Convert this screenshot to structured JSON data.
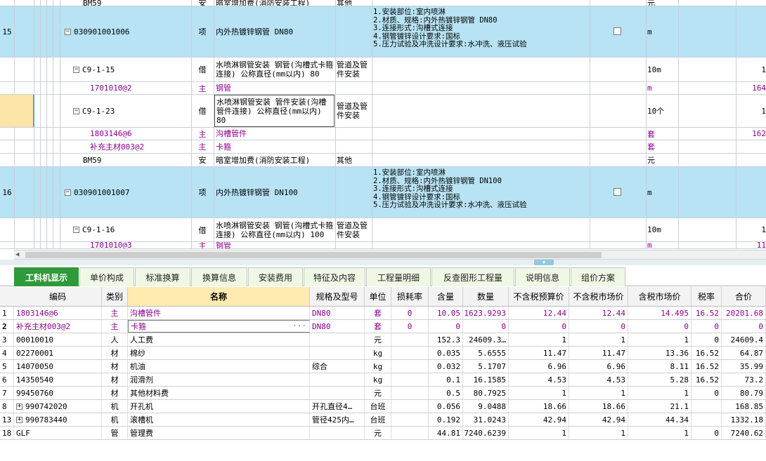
{
  "upper": {
    "columns": [
      "",
      "",
      "code",
      "type",
      "name",
      "category",
      "features",
      "check",
      "unit",
      "extra1",
      "extra2"
    ],
    "rows": [
      {
        "num": "",
        "code": "BM59",
        "type": "安",
        "name": "暗室增加费(消防安装工程)",
        "cat": "其他",
        "desc": [],
        "unit": "元",
        "tail": "",
        "blue": false,
        "purple": false
      },
      {
        "num": "15",
        "code": "030901001006",
        "type": "项",
        "name": "内外热镀锌钢管 DN80",
        "cat": "",
        "desc": [
          "1.安装部位:室内喷淋",
          "2.材质、规格:内外热镀锌钢管 DN80",
          "3.连接形式:沟槽式连接",
          "4.钢管镀锌设计要求:国标",
          "5.压力试验及冲洗设计要求:水冲洗、液压试验"
        ],
        "unit": "m",
        "tail": "",
        "blue": true,
        "purple": false
      },
      {
        "num": "",
        "code": "C9-1-15",
        "type": "借",
        "name": "水喷淋钢管安装 钢管(沟槽式卡箍连接) 公称直径(mm以内) 80",
        "cat": "管道及管件安装",
        "desc": [],
        "unit": "10m",
        "tail": "1",
        "blue": false,
        "purple": false
      },
      {
        "num": "",
        "code": "1701010@2",
        "type": "主",
        "name": "钢管",
        "cat": "",
        "desc": [],
        "unit": "m",
        "tail": "164",
        "blue": false,
        "purple": true
      },
      {
        "num": "",
        "code": "C9-1-23",
        "type": "借",
        "name": "水喷淋钢管安装 管件安装(沟槽管件连接) 公称直径(mm以内) 80",
        "cat": "管道及管件安装",
        "desc": [],
        "unit": "10个",
        "tail": "1",
        "blue": false,
        "purple": false
      },
      {
        "num": "",
        "code": "1803146@6",
        "type": "主",
        "name": "沟槽管件",
        "cat": "",
        "desc": [],
        "unit": "套",
        "tail": "162",
        "blue": false,
        "purple": true
      },
      {
        "num": "",
        "code": "补充主材003@2",
        "type": "主",
        "name": "卡箍",
        "cat": "",
        "desc": [],
        "unit": "套",
        "tail": "",
        "blue": false,
        "purple": true
      },
      {
        "num": "",
        "code": "BM59",
        "type": "安",
        "name": "暗室增加费(消防安装工程)",
        "cat": "其他",
        "desc": [],
        "unit": "元",
        "tail": "",
        "blue": false,
        "purple": false
      },
      {
        "num": "16",
        "code": "030901001007",
        "type": "项",
        "name": "内外热镀锌钢管 DN100",
        "cat": "",
        "desc": [
          "1.安装部位:室内喷淋",
          "2.材质、规格:内外热镀锌钢管 DN100",
          "3.连接形式:沟槽式连接",
          "4.钢管镀锌设计要求:国标",
          "5.压力试验及冲洗设计要求:水冲洗、液压试验"
        ],
        "unit": "m",
        "tail": "",
        "blue": true,
        "purple": false
      },
      {
        "num": "",
        "code": "C9-1-16",
        "type": "借",
        "name": "水喷淋钢管安装 钢管(沟槽式卡箍连接) 公称直径(mm以内) 100",
        "cat": "管道及管件安装",
        "desc": [],
        "unit": "10m",
        "tail": "1",
        "blue": false,
        "purple": false
      },
      {
        "num": "",
        "code": "1701010@3",
        "type": "主",
        "name": "钢管",
        "cat": "",
        "desc": [],
        "unit": "m",
        "tail": "11",
        "blue": false,
        "purple": true
      }
    ]
  },
  "tabs": [
    "工料机显示",
    "单价构成",
    "标准换算",
    "换算信息",
    "安装费用",
    "特征及内容",
    "工程量明细",
    "反查图形工程量",
    "说明信息",
    "组价方案"
  ],
  "lower": {
    "headers": [
      "编码",
      "类别",
      "名称",
      "规格及型号",
      "单位",
      "损耗率",
      "含量",
      "数量",
      "不含税预算价",
      "不含税市场价",
      "含税市场价",
      "税率",
      "合价"
    ],
    "rows": [
      {
        "idx": "1",
        "code": "1803146@6",
        "type": "主",
        "name": "沟槽管件",
        "spec": "DN80",
        "unit": "套",
        "loss": "0",
        "qty": "10.05",
        "amount": "1623.9293",
        "p1": "12.44",
        "p2": "12.44",
        "p3": "14.495",
        "tax": "16.52",
        "total": "20201.68",
        "purple": true,
        "plus": false
      },
      {
        "idx": "2",
        "code": "补充主材003@2",
        "type": "主",
        "name": "卡箍",
        "spec": "DN80",
        "unit": "套",
        "loss": "0",
        "qty": "0",
        "amount": "0",
        "p1": "0",
        "p2": "0",
        "p3": "0",
        "tax": "0",
        "total": "0",
        "purple": true,
        "plus": false
      },
      {
        "idx": "3",
        "code": "00010010",
        "type": "人",
        "name": "人工费",
        "spec": "",
        "unit": "元",
        "loss": "",
        "qty": "152.3",
        "amount": "24609.3…",
        "p1": "1",
        "p2": "1",
        "p3": "1",
        "tax": "0",
        "total": "24609.4",
        "purple": false,
        "plus": false
      },
      {
        "idx": "4",
        "code": "02270001",
        "type": "材",
        "name": "棉纱",
        "spec": "",
        "unit": "kg",
        "loss": "",
        "qty": "0.035",
        "amount": "5.6555",
        "p1": "11.47",
        "p2": "11.47",
        "p3": "13.36",
        "tax": "16.52",
        "total": "64.87",
        "purple": false,
        "plus": false
      },
      {
        "idx": "5",
        "code": "14070050",
        "type": "材",
        "name": "机油",
        "spec": "综合",
        "unit": "kg",
        "loss": "",
        "qty": "0.032",
        "amount": "5.1707",
        "p1": "6.96",
        "p2": "6.96",
        "p3": "8.11",
        "tax": "16.52",
        "total": "35.99",
        "purple": false,
        "plus": false
      },
      {
        "idx": "6",
        "code": "14350540",
        "type": "材",
        "name": "润滑剂",
        "spec": "",
        "unit": "kg",
        "loss": "",
        "qty": "0.1",
        "amount": "16.1585",
        "p1": "4.53",
        "p2": "4.53",
        "p3": "5.28",
        "tax": "16.52",
        "total": "73.2",
        "purple": false,
        "plus": false
      },
      {
        "idx": "7",
        "code": "99450760",
        "type": "材",
        "name": "其他材料费",
        "spec": "",
        "unit": "元",
        "loss": "",
        "qty": "0.5",
        "amount": "80.7925",
        "p1": "1",
        "p2": "1",
        "p3": "1",
        "tax": "0",
        "total": "80.79",
        "purple": false,
        "plus": false
      },
      {
        "idx": "8",
        "code": "990742020",
        "type": "机",
        "name": "开孔机",
        "spec": "开孔直径4…",
        "unit": "台班",
        "loss": "",
        "qty": "0.056",
        "amount": "9.0488",
        "p1": "18.66",
        "p2": "18.66",
        "p3": "21.1",
        "tax": "",
        "total": "168.85",
        "purple": false,
        "plus": true
      },
      {
        "idx": "13",
        "code": "990783440",
        "type": "机",
        "name": "滚槽机",
        "spec": "管径425内…",
        "unit": "台班",
        "loss": "",
        "qty": "0.192",
        "amount": "31.0243",
        "p1": "42.94",
        "p2": "42.94",
        "p3": "44.34",
        "tax": "",
        "total": "1332.18",
        "purple": false,
        "plus": true
      },
      {
        "idx": "18",
        "code": "GLF",
        "type": "管",
        "name": "管理费",
        "spec": "",
        "unit": "元",
        "loss": "",
        "qty": "44.81",
        "amount": "7240.6239",
        "p1": "1",
        "p2": "1",
        "p3": "1",
        "tax": "0",
        "total": "7240.62",
        "purple": false,
        "plus": false
      }
    ]
  },
  "colors": {
    "blue_row": "#b7e3f4",
    "purple": "#8b008b",
    "tab_active": "#2f9a3a",
    "header_name": "#ffeab0"
  },
  "icons": {
    "expander": "minus-box-icon",
    "plus": "plus-box-icon",
    "ellipsis": "ellipsis-icon",
    "arrow": "left-arrow-icon"
  }
}
